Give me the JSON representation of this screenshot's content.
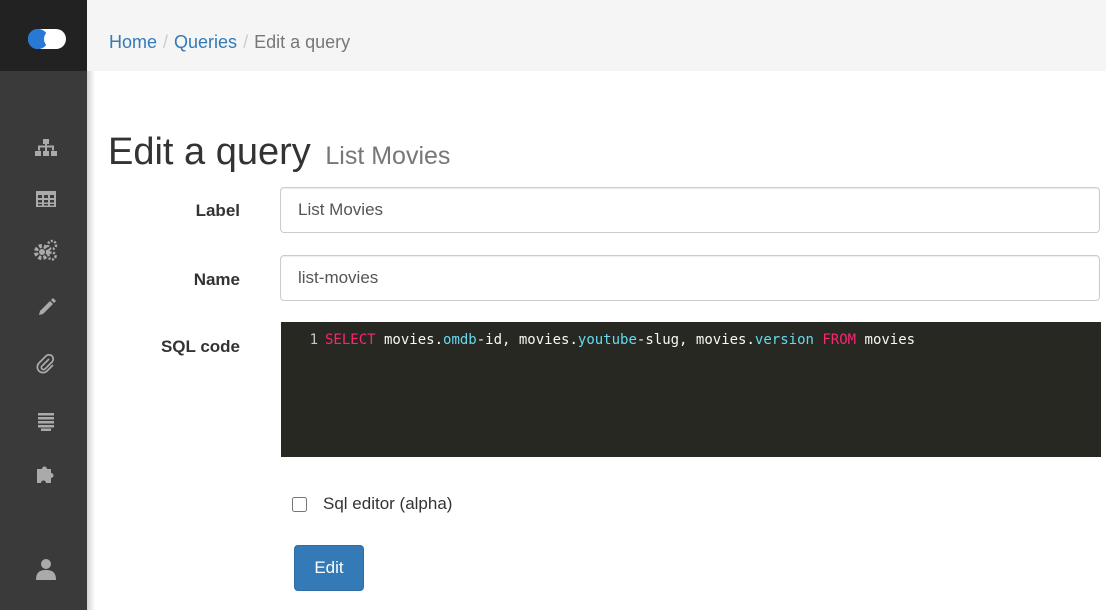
{
  "breadcrumb": {
    "home": "Home",
    "separator1": "/",
    "queries": "Queries",
    "separator2": "/",
    "current": "Edit a query"
  },
  "page": {
    "title": "Edit a query",
    "subtitle": "List Movies"
  },
  "form": {
    "label": {
      "caption": "Label",
      "value": "List Movies"
    },
    "name": {
      "caption": "Name",
      "value": "list-movies"
    },
    "sql": {
      "caption": "SQL code",
      "line_number": "1",
      "tokens": [
        {
          "text": "SELECT",
          "kind": "keyword"
        },
        {
          "text": " movies.",
          "kind": "plain"
        },
        {
          "text": "omdb",
          "kind": "function"
        },
        {
          "text": "-id, movies.",
          "kind": "plain"
        },
        {
          "text": "youtube",
          "kind": "function"
        },
        {
          "text": "-slug, movies.",
          "kind": "plain"
        },
        {
          "text": "version",
          "kind": "function"
        },
        {
          "text": " ",
          "kind": "plain"
        },
        {
          "text": "FROM",
          "kind": "keyword"
        },
        {
          "text": " movies",
          "kind": "plain"
        }
      ]
    },
    "sql_editor_checkbox": {
      "label": "Sql editor (alpha)",
      "checked": false
    },
    "submit_label": "Edit"
  },
  "sidebar": {
    "logo": "toggle-logo-icon",
    "items": [
      {
        "icon": "sitemap-icon"
      },
      {
        "icon": "table-icon"
      },
      {
        "icon": "cogs-icon"
      },
      {
        "icon": "pencil-icon"
      },
      {
        "icon": "paperclip-icon"
      },
      {
        "icon": "list-icon"
      },
      {
        "icon": "puzzle-piece-icon"
      },
      {
        "icon": "user-icon"
      }
    ]
  },
  "colors": {
    "accent": "#337ab7",
    "sidebar_bg": "#3a3a3a",
    "sidebar_top_bg": "#222222",
    "editor_bg": "#272822",
    "keyword": "#f92672",
    "function": "#66d9ef"
  }
}
